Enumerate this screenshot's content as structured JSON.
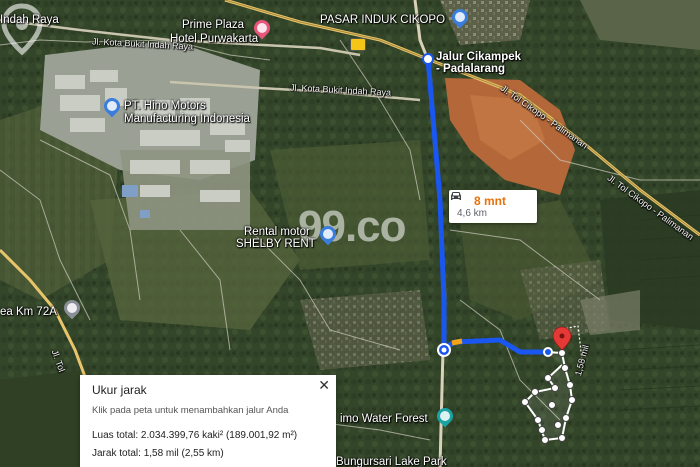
{
  "map": {
    "type": "satellite",
    "colors": {
      "route": "#1a56f0",
      "route_highlight": "#f3a316",
      "pin": "#e53935",
      "poi_pink": "#e8557a",
      "poi_blue": "#3b7ddd",
      "poi_teal": "#1aa3a3",
      "highway": "#e8c46a"
    },
    "labels": {
      "indah_raya": "Indah Raya",
      "prime_plaza_line1": "Prime Plaza",
      "prime_plaza_line2": "Hotel Purwakarta",
      "pasar_induk": "PASAR INDUK CIKOPO",
      "jl_kota_bukit_1": "Jl. Kota Bukit Indah Raya",
      "jl_kota_bukit_2": "Jl. Kota Bukit Indah Raya",
      "jalur_line1": "Jalur Cikampek",
      "jalur_line2": "- Padalarang",
      "hino_line1": "PT. Hino Motors",
      "hino_line2": "Manufacturing Indonesia",
      "jl_toll_1": "Jl. Tol Cikopo - Palimanan",
      "jl_toll_2": "Jl. Tol Cikopo - Palimanan",
      "rental_line1": "Rental motor",
      "rental_line2": "SHELBY RENT",
      "rest_area": "ea Km 72A",
      "jl_tol_left": "Jl. Tol",
      "mil_label": "1,58 mil",
      "water_forest": "imo Water Forest",
      "lake_park": "Bungursari Lake Park"
    },
    "icons": [
      "hotel-icon",
      "shopping-icon",
      "hotel-bed-icon",
      "location-pin-icon",
      "water-park-icon",
      "highway-shield-icon",
      "car-icon",
      "close-icon"
    ]
  },
  "route_info": {
    "time": "8 mnt",
    "distance": "4,6 km"
  },
  "watermark": {
    "text": "99.co"
  },
  "measure_panel": {
    "title": "Ukur jarak",
    "hint": "Klik pada peta untuk menambahkan jalur Anda",
    "area": "Luas total: 2.034.399,76 kaki² (189.001,92 m²)",
    "distance": "Jarak total: 1,58 mil (2,55 km)",
    "close_symbol": "✕"
  }
}
